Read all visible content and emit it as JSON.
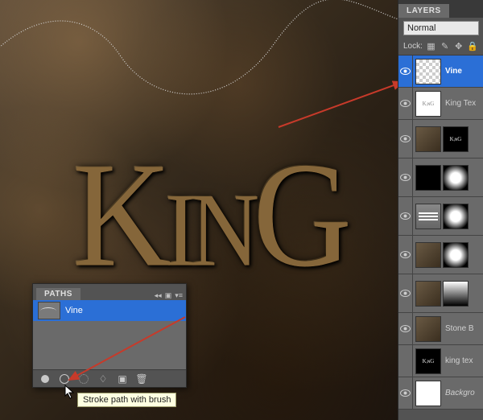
{
  "canvas": {
    "artwork_text": "KinG"
  },
  "paths_panel": {
    "title": "PATHS",
    "item": "Vine",
    "tooltip": "Stroke path with brush"
  },
  "layers_panel": {
    "title": "LAYERS",
    "blend_mode": "Normal",
    "lock_label": "Lock:",
    "layers": [
      {
        "name": "Vine"
      },
      {
        "name": "King Tex"
      },
      {
        "name": ""
      },
      {
        "name": ""
      },
      {
        "name": ""
      },
      {
        "name": ""
      },
      {
        "name": ""
      },
      {
        "name": "Stone B"
      },
      {
        "name": "king tex"
      },
      {
        "name": "Backgro"
      }
    ]
  }
}
